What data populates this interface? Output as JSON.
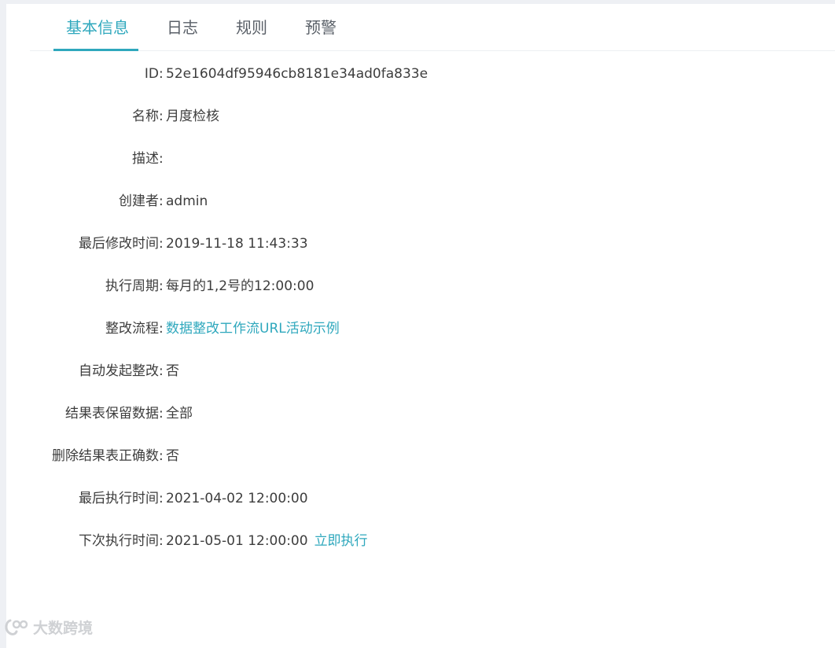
{
  "tabs": [
    {
      "label": "基本信息",
      "active": true
    },
    {
      "label": "日志",
      "active": false
    },
    {
      "label": "规则",
      "active": false
    },
    {
      "label": "预警",
      "active": false
    }
  ],
  "fields": {
    "id": {
      "label": "ID",
      "value": "52e1604df95946cb8181e34ad0fa833e"
    },
    "name": {
      "label": "名称",
      "value": "月度检核"
    },
    "description": {
      "label": "描述",
      "value": ""
    },
    "creator": {
      "label": "创建者",
      "value": "admin"
    },
    "last_modified": {
      "label": "最后修改时间",
      "value": "2019-11-18 11:43:33"
    },
    "schedule": {
      "label": "执行周期",
      "value": "每月的1,2号的12:00:00"
    },
    "workflow": {
      "label": "整改流程",
      "value": "数据整改工作流URL活动示例"
    },
    "auto_start": {
      "label": "自动发起整改",
      "value": "否"
    },
    "keep_data": {
      "label": "结果表保留数据",
      "value": "全部"
    },
    "delete_correct": {
      "label": "删除结果表正确数",
      "value": "否"
    },
    "last_run": {
      "label": "最后执行时间",
      "value": "2021-04-02 12:00:00"
    },
    "next_run": {
      "label": "下次执行时间",
      "value": "2021-05-01 12:00:00",
      "action": "立即执行"
    }
  },
  "watermark": {
    "text": "大数跨境"
  },
  "colors": {
    "accent": "#2fa8bd",
    "text": "#3d3d3d"
  }
}
